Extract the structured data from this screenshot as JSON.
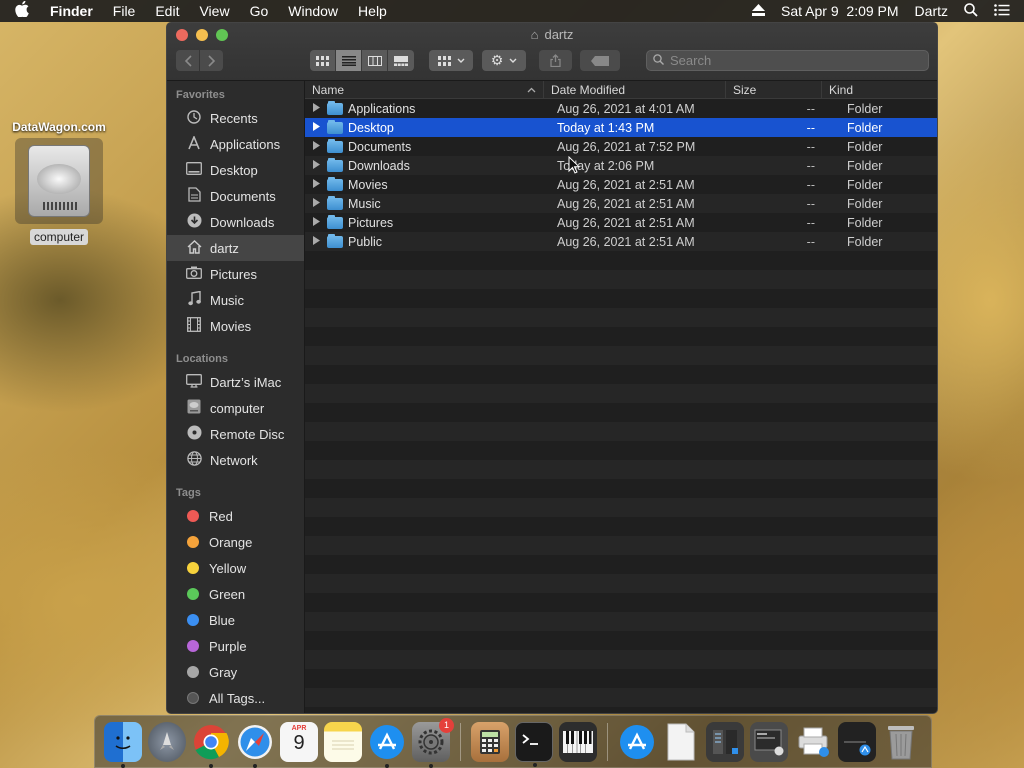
{
  "menubar": {
    "app_name": "Finder",
    "menus": [
      "File",
      "Edit",
      "View",
      "Go",
      "Window",
      "Help"
    ],
    "clock": "Sat Apr 9  2:09 PM",
    "user": "Dartz"
  },
  "desktop": {
    "site_label": "DataWagon.com",
    "drive_label": "computer"
  },
  "window": {
    "title": "dartz",
    "search_placeholder": "Search"
  },
  "sidebar": {
    "favorites_header": "Favorites",
    "favorites": [
      {
        "label": "Recents",
        "icon": "clock-icon"
      },
      {
        "label": "Applications",
        "icon": "applications-icon"
      },
      {
        "label": "Desktop",
        "icon": "desktop-icon"
      },
      {
        "label": "Documents",
        "icon": "document-icon"
      },
      {
        "label": "Downloads",
        "icon": "download-icon"
      },
      {
        "label": "dartz",
        "icon": "home-icon"
      },
      {
        "label": "Pictures",
        "icon": "camera-icon"
      },
      {
        "label": "Music",
        "icon": "music-note-icon"
      },
      {
        "label": "Movies",
        "icon": "film-icon"
      }
    ],
    "locations_header": "Locations",
    "locations": [
      {
        "label": "Dartz’s iMac",
        "icon": "monitor-icon"
      },
      {
        "label": "computer",
        "icon": "hard-drive-icon"
      },
      {
        "label": "Remote Disc",
        "icon": "disc-icon"
      },
      {
        "label": "Network",
        "icon": "globe-icon"
      }
    ],
    "tags_header": "Tags",
    "tags": [
      {
        "label": "Red",
        "color": "#ef5a55"
      },
      {
        "label": "Orange",
        "color": "#f5a33b"
      },
      {
        "label": "Yellow",
        "color": "#f7d23c"
      },
      {
        "label": "Green",
        "color": "#5bc85a"
      },
      {
        "label": "Blue",
        "color": "#3b8ff2"
      },
      {
        "label": "Purple",
        "color": "#b866d9"
      },
      {
        "label": "Gray",
        "color": "#a7a7a7"
      },
      {
        "label": "All Tags...",
        "color": ""
      }
    ]
  },
  "columns": {
    "name": "Name",
    "date": "Date Modified",
    "size": "Size",
    "kind": "Kind"
  },
  "files": [
    {
      "name": "Applications",
      "date": "Aug 26, 2021 at 4:01 AM",
      "size": "--",
      "kind": "Folder",
      "selected": false
    },
    {
      "name": "Desktop",
      "date": "Today at 1:43 PM",
      "size": "--",
      "kind": "Folder",
      "selected": true
    },
    {
      "name": "Documents",
      "date": "Aug 26, 2021 at 7:52 PM",
      "size": "--",
      "kind": "Folder",
      "selected": false
    },
    {
      "name": "Downloads",
      "date": "Today at 2:06 PM",
      "size": "--",
      "kind": "Folder",
      "selected": false
    },
    {
      "name": "Movies",
      "date": "Aug 26, 2021 at 2:51 AM",
      "size": "--",
      "kind": "Folder",
      "selected": false
    },
    {
      "name": "Music",
      "date": "Aug 26, 2021 at 2:51 AM",
      "size": "--",
      "kind": "Folder",
      "selected": false
    },
    {
      "name": "Pictures",
      "date": "Aug 26, 2021 at 2:51 AM",
      "size": "--",
      "kind": "Folder",
      "selected": false
    },
    {
      "name": "Public",
      "date": "Aug 26, 2021 at 2:51 AM",
      "size": "--",
      "kind": "Folder",
      "selected": false
    }
  ],
  "dock": {
    "apps": [
      {
        "name": "finder-icon",
        "color": "#3a8ee6",
        "running": true
      },
      {
        "name": "launchpad-icon",
        "color": "#5b6470",
        "running": false
      },
      {
        "name": "chrome-icon",
        "color": "#e9e9e9",
        "running": true
      },
      {
        "name": "safari-icon",
        "color": "#2f8fea",
        "running": true
      },
      {
        "name": "calendar-icon",
        "color": "#f4f4f4",
        "running": false
      },
      {
        "name": "notes-icon",
        "color": "#f6e27a",
        "running": false
      },
      {
        "name": "app-store-icon",
        "color": "#1e8ff0",
        "running": true
      },
      {
        "name": "system-preferences-icon",
        "color": "#8a8a8a",
        "running": true
      }
    ],
    "apps2": [
      {
        "name": "calculator-icon",
        "color": "#c98b4a",
        "running": false
      },
      {
        "name": "terminal-icon",
        "color": "#1a1a1a",
        "running": true
      },
      {
        "name": "piano-icon",
        "color": "#333333",
        "running": false
      }
    ],
    "stacks": [
      {
        "name": "app-store-folder-icon",
        "color": "#1e8ff0"
      },
      {
        "name": "document-stack-icon",
        "color": "#f1f1f1"
      },
      {
        "name": "screenshot-stack-icon",
        "color": "#3a3a3a"
      },
      {
        "name": "window-stack-icon",
        "color": "#555555"
      },
      {
        "name": "printer-stack-icon",
        "color": "#e0e0e0"
      },
      {
        "name": "downloads-stack-icon",
        "color": "#2a2a2a"
      },
      {
        "name": "trash-icon",
        "color": "#8f8f8f"
      }
    ],
    "calendar_month": "APR",
    "calendar_day": "9",
    "prefs_badge": "1"
  }
}
